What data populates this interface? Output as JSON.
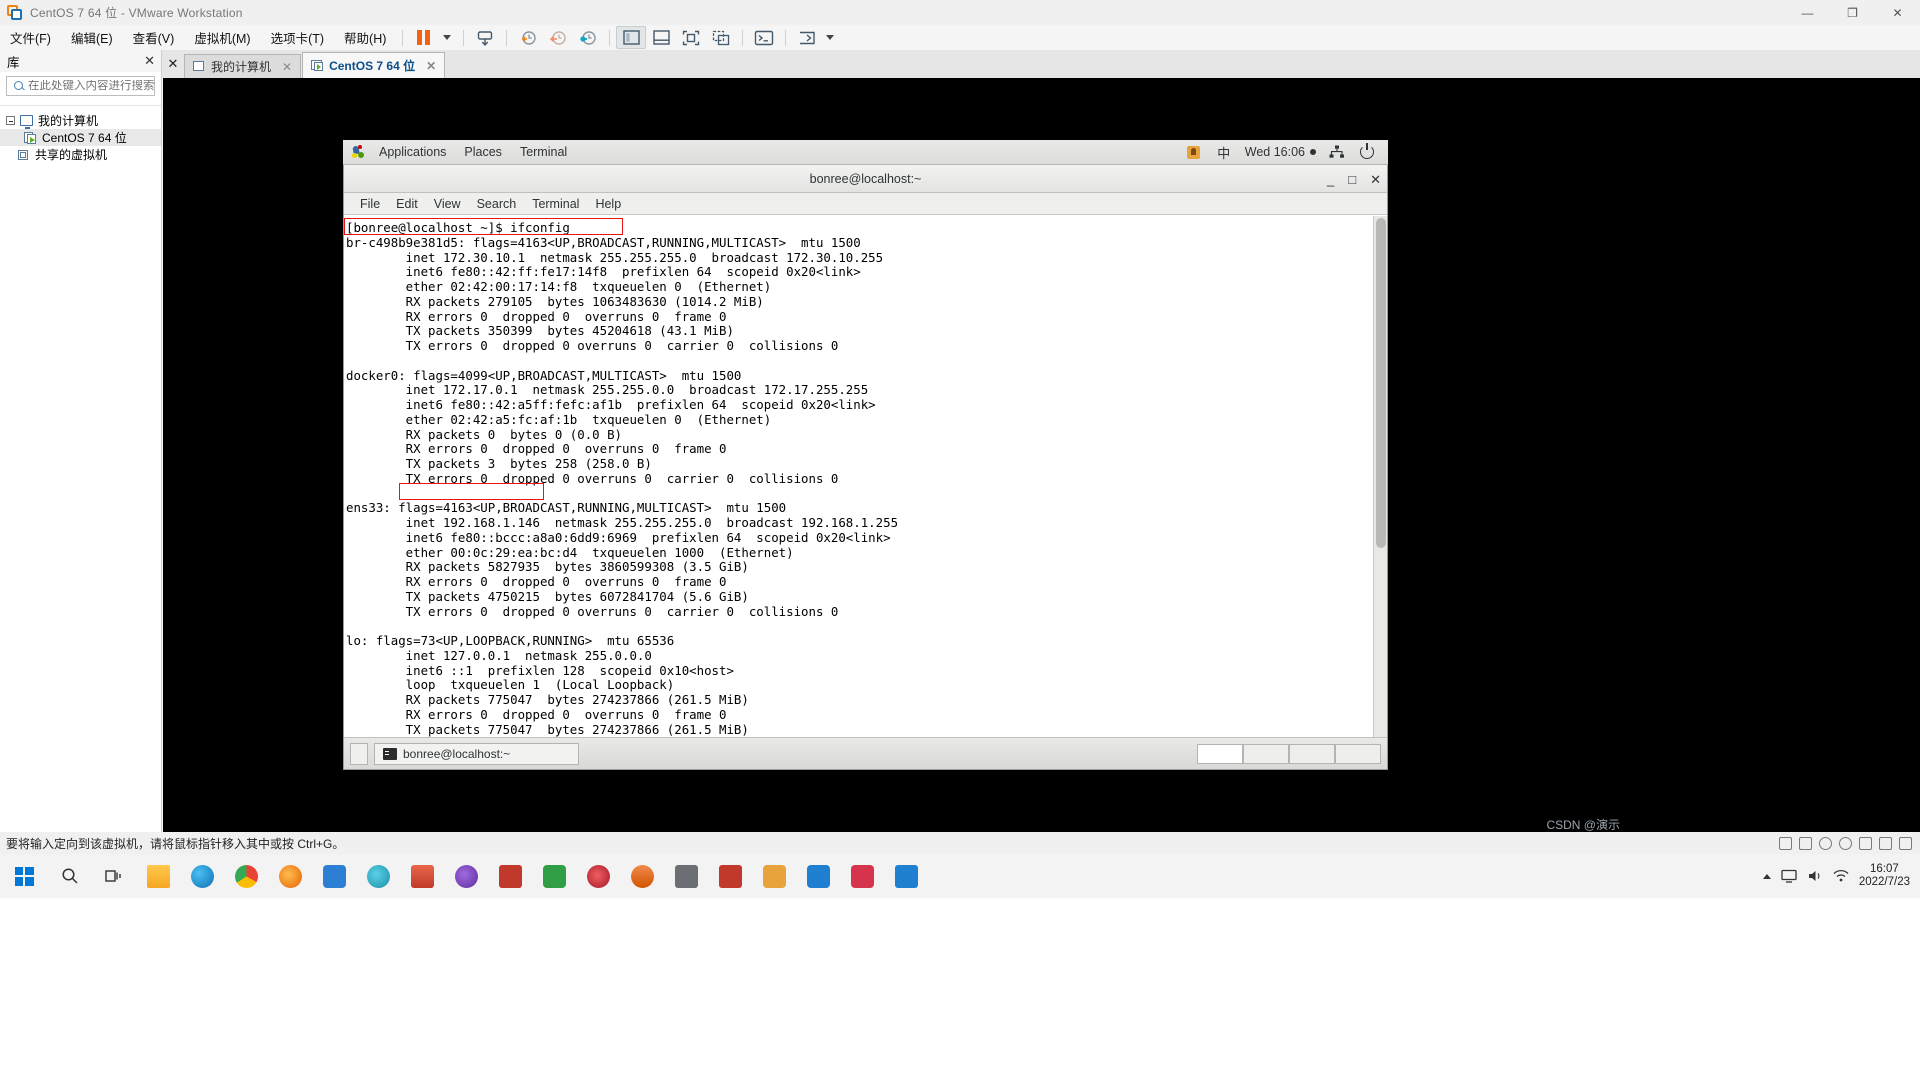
{
  "window": {
    "title": "CentOS 7 64 位 - VMware Workstation",
    "minimize": "—",
    "maximize": "❐",
    "close": "✕"
  },
  "menubar": {
    "items": [
      {
        "label": "文件(F)"
      },
      {
        "label": "编辑(E)"
      },
      {
        "label": "查看(V)"
      },
      {
        "label": "虚拟机(M)"
      },
      {
        "label": "选项卡(T)"
      },
      {
        "label": "帮助(H)"
      }
    ]
  },
  "sidebar": {
    "header": "库",
    "close": "✕",
    "search_placeholder": "在此处键入内容进行搜索",
    "search_value": "",
    "tree": [
      {
        "label": "我的计算机",
        "level": 0,
        "selected": false
      },
      {
        "label": "CentOS 7 64 位",
        "level": 1,
        "selected": true
      },
      {
        "label": "共享的虚拟机",
        "level": 0,
        "selected": false
      }
    ]
  },
  "tabs": [
    {
      "label": "我的计算机",
      "active": false,
      "close": "✕"
    },
    {
      "label": "CentOS 7 64 位",
      "active": true,
      "close": "✕"
    }
  ],
  "vm_desktop": {
    "panel": {
      "applications": "Applications",
      "places": "Places",
      "terminal": "Terminal",
      "input_method": "中",
      "clock": "Wed 16:06"
    },
    "terminal_window": {
      "title": "bonree@localhost:~",
      "minimize": "_",
      "maximize": "□",
      "close": "✕",
      "menu": [
        "File",
        "Edit",
        "View",
        "Search",
        "Terminal",
        "Help"
      ],
      "taskbar_item": "bonree@localhost:~",
      "output": "[bonree@localhost ~]$ ifconfig\nbr-c498b9e381d5: flags=4163<UP,BROADCAST,RUNNING,MULTICAST>  mtu 1500\n        inet 172.30.10.1  netmask 255.255.255.0  broadcast 172.30.10.255\n        inet6 fe80::42:ff:fe17:14f8  prefixlen 64  scopeid 0x20<link>\n        ether 02:42:00:17:14:f8  txqueuelen 0  (Ethernet)\n        RX packets 279105  bytes 1063483630 (1014.2 MiB)\n        RX errors 0  dropped 0  overruns 0  frame 0\n        TX packets 350399  bytes 45204618 (43.1 MiB)\n        TX errors 0  dropped 0 overruns 0  carrier 0  collisions 0\n\ndocker0: flags=4099<UP,BROADCAST,MULTICAST>  mtu 1500\n        inet 172.17.0.1  netmask 255.255.0.0  broadcast 172.17.255.255\n        inet6 fe80::42:a5ff:fefc:af1b  prefixlen 64  scopeid 0x20<link>\n        ether 02:42:a5:fc:af:1b  txqueuelen 0  (Ethernet)\n        RX packets 0  bytes 0 (0.0 B)\n        RX errors 0  dropped 0  overruns 0  frame 0\n        TX packets 3  bytes 258 (258.0 B)\n        TX errors 0  dropped 0 overruns 0  carrier 0  collisions 0\n\nens33: flags=4163<UP,BROADCAST,RUNNING,MULTICAST>  mtu 1500\n        inet 192.168.1.146  netmask 255.255.255.0  broadcast 192.168.1.255\n        inet6 fe80::bccc:a8a0:6dd9:6969  prefixlen 64  scopeid 0x20<link>\n        ether 00:0c:29:ea:bc:d4  txqueuelen 1000  (Ethernet)\n        RX packets 5827935  bytes 3860599308 (3.5 GiB)\n        RX errors 0  dropped 0  overruns 0  frame 0\n        TX packets 4750215  bytes 6072841704 (5.6 GiB)\n        TX errors 0  dropped 0 overruns 0  carrier 0  collisions 0\n\nlo: flags=73<UP,LOOPBACK,RUNNING>  mtu 65536\n        inet 127.0.0.1  netmask 255.0.0.0\n        inet6 ::1  prefixlen 128  scopeid 0x10<host>\n        loop  txqueuelen 1  (Local Loopback)\n        RX packets 775047  bytes 274237866 (261.5 MiB)\n        RX errors 0  dropped 0  overruns 0  frame 0\n        TX packets 775047  bytes 274237866 (261.5 MiB)"
    },
    "highlights": [
      {
        "label": "[bonree@localhost ~]$ ifconfig",
        "color": "#e8140f"
      },
      {
        "label": "inet 192.168.1.146",
        "color": "#e8140f"
      }
    ]
  },
  "status_bar": {
    "message": "要将输入定向到该虚拟机，请将鼠标指针移入其中或按 Ctrl+G。"
  },
  "taskbar": {
    "clock_time": "16:07",
    "clock_date": "2022/7/23",
    "watermark": "CSDN @演示"
  },
  "colors": {
    "accent_orange": "#f2620f",
    "accent_blue": "#1a6fb5",
    "highlight_red": "#e8140f",
    "terminal_bg": "#ffffff",
    "terminal_fg": "#000000"
  }
}
